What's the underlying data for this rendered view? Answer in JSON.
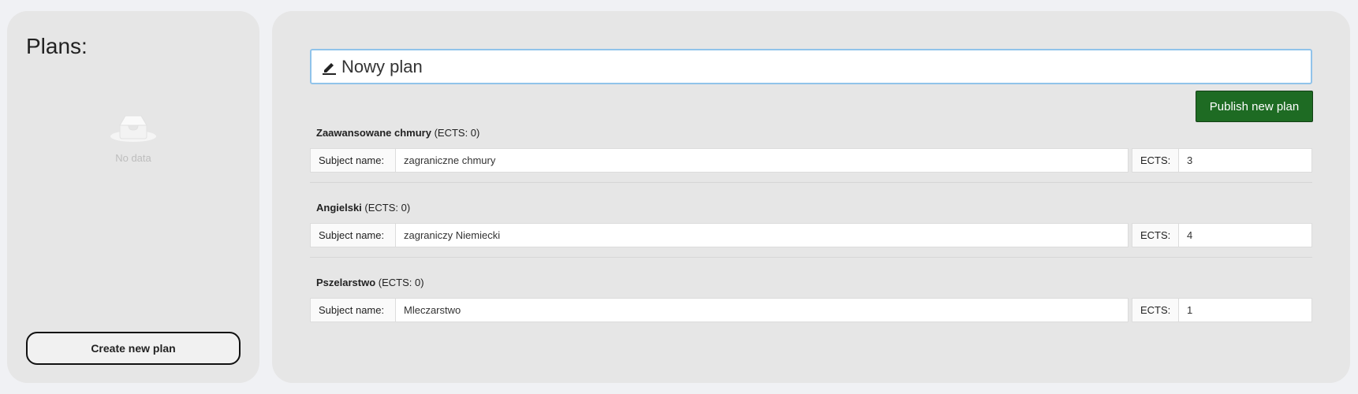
{
  "sidebar": {
    "title": "Plans:",
    "empty_text": "No data",
    "create_button_label": "Create new plan"
  },
  "editor": {
    "plan_name": "Nowy plan",
    "publish_button_label": "Publish new plan",
    "subject_name_label": "Subject name:",
    "ects_label": "ECTS:",
    "subjects": [
      {
        "title": "Zaawansowane chmury",
        "ects_summary": "(ECTS: 0)",
        "subject_name": "zagraniczne chmury",
        "ects": "3"
      },
      {
        "title": "Angielski",
        "ects_summary": "(ECTS: 0)",
        "subject_name": "zagraniczy Niemiecki",
        "ects": "4"
      },
      {
        "title": "Pszelarstwo",
        "ects_summary": "(ECTS: 0)",
        "subject_name": "Mleczarstwo",
        "ects": "1"
      }
    ]
  }
}
